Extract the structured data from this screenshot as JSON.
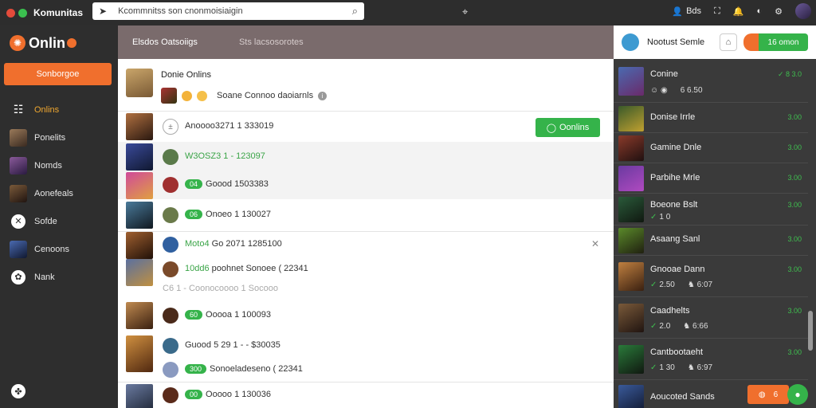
{
  "colors": {
    "accent_orange": "#f06f2d",
    "accent_green": "#35b34a",
    "sidebar_bg": "#2e2e2e",
    "tabbar_bg": "#7a6b6c"
  },
  "topbar": {
    "app_title": "Komunitas",
    "search_value": "Kcommnitss son cnonmoisiaigin",
    "search_icon": "search-icon",
    "user_label": "Bds"
  },
  "sidebar": {
    "brand": "Onlin",
    "primary_button": "Sonborgoe",
    "items": [
      {
        "label": "Onlins",
        "icon": "grid-icon"
      },
      {
        "label": "Ponelits",
        "icon": "avatar-thumb"
      },
      {
        "label": "Nomds",
        "icon": "avatar-thumb"
      },
      {
        "label": "Aonefeals",
        "icon": "avatar-thumb"
      },
      {
        "label": "Sofde",
        "icon": "star-icon"
      },
      {
        "label": "Cenoons",
        "icon": "avatar-thumb"
      },
      {
        "label": "Nank",
        "icon": "circle-icon"
      }
    ]
  },
  "main": {
    "tabs": [
      "Elsdos Oatsoiigs",
      "Sts lacsosorotes"
    ],
    "profile": {
      "name": "Donie Onlins",
      "subtitle": "Soane Connoo daoiarnls"
    },
    "online_button": "Oonlins",
    "feed": [
      {
        "text": "Anoooo3271 1 333019"
      },
      {
        "text": "W3OSZ3 1 - 123097",
        "green": true
      },
      {
        "pill": "04",
        "text": "Goood 1503383"
      },
      {
        "pill": "06",
        "text": "Onoeo 1 130027"
      },
      {
        "text_green": "Moto4",
        "text": "Go 2071 1285100"
      },
      {
        "text_green": "10dd6",
        "text": "poohnet  Sonoee ( 22341"
      },
      {
        "text": "C6 1 -  Coonocoooo 1 Socooo"
      },
      {
        "pill": "60",
        "text": "Ooooa 1 100093"
      },
      {
        "text": "Guood 5 29 1 - - $30035"
      },
      {
        "pill": "300",
        "text": "Sonoeladeseno ( 22341"
      },
      {
        "pill": "00",
        "text": "Ooooo 1 130036"
      }
    ]
  },
  "rightpanel": {
    "title": "Nootust Semle",
    "action_button": "16 omon",
    "items": [
      {
        "name": "Conine",
        "status": "✓ 8 3.0",
        "meta": [
          "6 6.50"
        ]
      },
      {
        "name": "Donise Irrle",
        "status": "3.00"
      },
      {
        "name": "Gamine Dnle",
        "status": "3.00"
      },
      {
        "name": "Parbihe Mrle",
        "status": "3.00"
      },
      {
        "name": "Boeone Bslt",
        "status": "3.00",
        "meta": [
          "1 0"
        ]
      },
      {
        "name": "Asaang Sanl",
        "status": "3.00"
      },
      {
        "name": "Gnooae Dann",
        "status": "3.00",
        "meta": [
          "2.50",
          "6:07"
        ]
      },
      {
        "name": "Caadhelts",
        "status": "3.00",
        "meta": [
          "2.0",
          "6:66"
        ]
      },
      {
        "name": "Cantbootaeht",
        "status": "3.00",
        "meta": [
          "1 30",
          "6:97"
        ]
      },
      {
        "name": "Aoucoted Sands",
        "status": ""
      }
    ],
    "footer_count": "6"
  }
}
